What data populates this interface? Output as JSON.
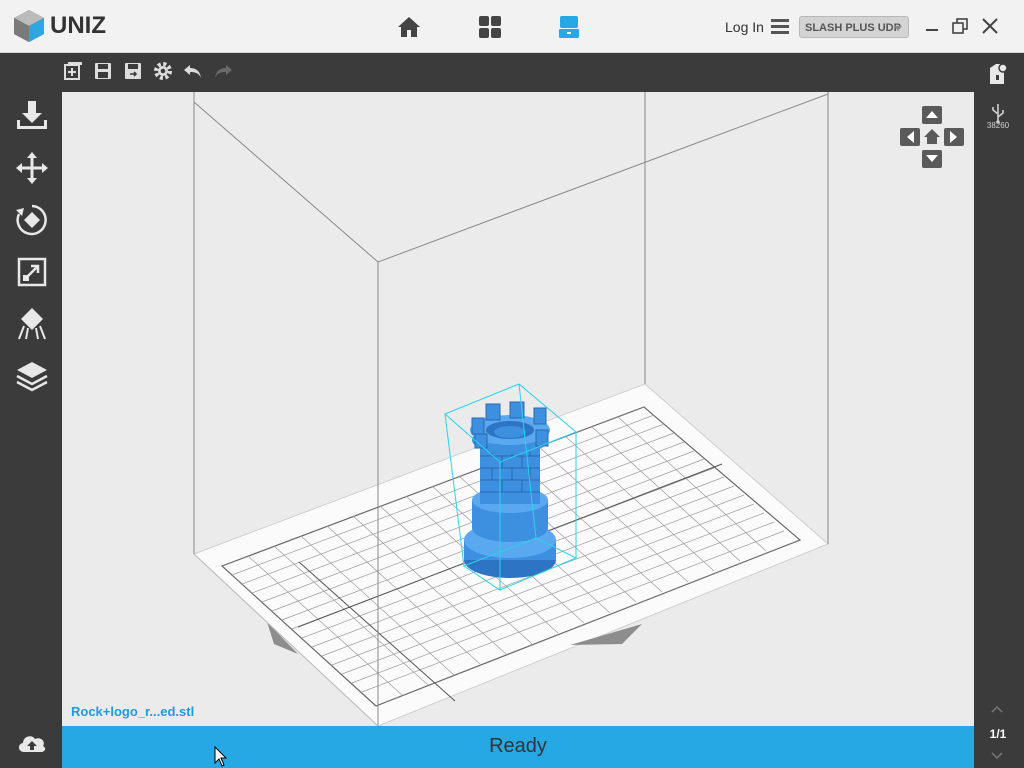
{
  "app": {
    "brand": "UNIZ"
  },
  "header": {
    "login_label": "Log In",
    "printer_selected": "SLASH PLUS UDP",
    "nav": [
      {
        "name": "home-icon"
      },
      {
        "name": "grid-icon"
      },
      {
        "name": "printer-icon",
        "active": true
      }
    ]
  },
  "toolbar": {
    "buttons": [
      "new-icon",
      "save-icon",
      "save-as-icon",
      "settings-icon",
      "undo-icon",
      "redo-icon"
    ]
  },
  "sidebar": {
    "tools": [
      "import-icon",
      "move-icon",
      "rotate-icon",
      "scale-icon",
      "support-icon",
      "slice-layers-icon"
    ]
  },
  "viewport": {
    "filename": "Rock+logo_r...ed.stl"
  },
  "status": {
    "text": "Ready"
  },
  "right_panel": {
    "usb_label": "38260",
    "page": "1/1"
  },
  "colors": {
    "accent": "#26a8e4",
    "model": "#3d8fe0",
    "bbox": "#2ad3ea"
  }
}
